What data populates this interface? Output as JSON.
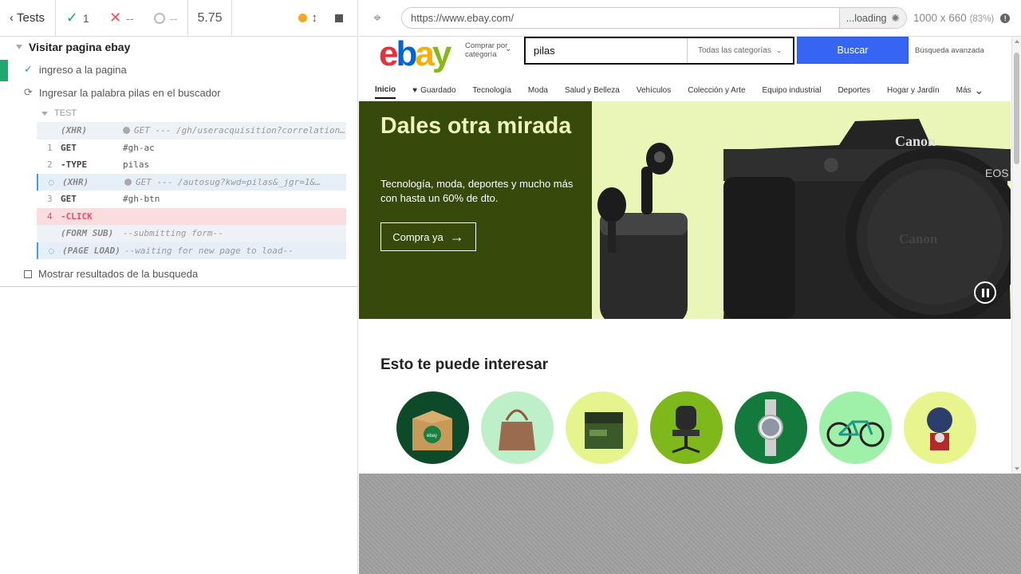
{
  "reporter": {
    "back_label": "Tests",
    "passed": "1",
    "failed": "--",
    "pending": "--",
    "duration": "5.75"
  },
  "suite": {
    "title": "Visitar pagina ebay",
    "tests": [
      {
        "title": "ingreso a la pagina",
        "state": "passed"
      },
      {
        "title": "Ingresar la palabra pilas en el buscador",
        "state": "running"
      },
      {
        "title": "Mostrar resultados de la busqueda",
        "state": "pending"
      }
    ],
    "group_label": "TEST",
    "commands": [
      {
        "num": "",
        "name": "(XHR)",
        "msg": "GET --- /gh/useracquisition?correlation=s…",
        "kind": "xhr"
      },
      {
        "num": "1",
        "name": "GET",
        "msg": "#gh-ac",
        "kind": "plain"
      },
      {
        "num": "2",
        "name": "-TYPE",
        "msg": "pilas",
        "kind": "plain"
      },
      {
        "num": "",
        "name": "(XHR)",
        "msg": "GET --- /autosug?kwd=pilas&_jgr=1&…",
        "kind": "xhr-pending"
      },
      {
        "num": "3",
        "name": "GET",
        "msg": "#gh-btn",
        "kind": "plain"
      },
      {
        "num": "4",
        "name": "-CLICK",
        "msg": "",
        "kind": "failing"
      },
      {
        "num": "",
        "name": "(FORM SUB)",
        "msg": "--submitting form--",
        "kind": "xhr"
      },
      {
        "num": "",
        "name": "(PAGE LOAD)",
        "msg": "--waiting for new page to load--",
        "kind": "xhr-pending"
      }
    ]
  },
  "aut": {
    "url": "https://www.ebay.com/",
    "loading": "...loading",
    "viewport": "1000 x 660",
    "scale": "(83%)"
  },
  "ebay": {
    "logo_letters": [
      "e",
      "b",
      "a",
      "y"
    ],
    "shop_by": "Comprar por categoría",
    "search_value": "pilas",
    "category": "Todas las categorías",
    "search_button": "Buscar",
    "advanced": "Búsqueda avanzada",
    "nav": [
      "Inicio",
      "Guardado",
      "Tecnología",
      "Moda",
      "Salud y Belleza",
      "Vehículos",
      "Colección y Arte",
      "Equipo industrial",
      "Deportes",
      "Hogar y Jardín",
      "Más"
    ],
    "hero_title": "Dales otra mirada",
    "hero_text": "Tecnología, moda, deportes y mucho más con hasta un 60% de dto.",
    "hero_cta": "Compra ya",
    "camera_brand": "Canon",
    "camera_model": "EOS",
    "box_badge": "ebay",
    "section_title": "Esto te puede interesar",
    "colors": {
      "brand_blue": "#3665f3",
      "hero_dark": "#364a0c",
      "hero_light": "#eaf6b8",
      "pass_green": "#1fa971",
      "fail_red": "#e94f5f"
    }
  }
}
